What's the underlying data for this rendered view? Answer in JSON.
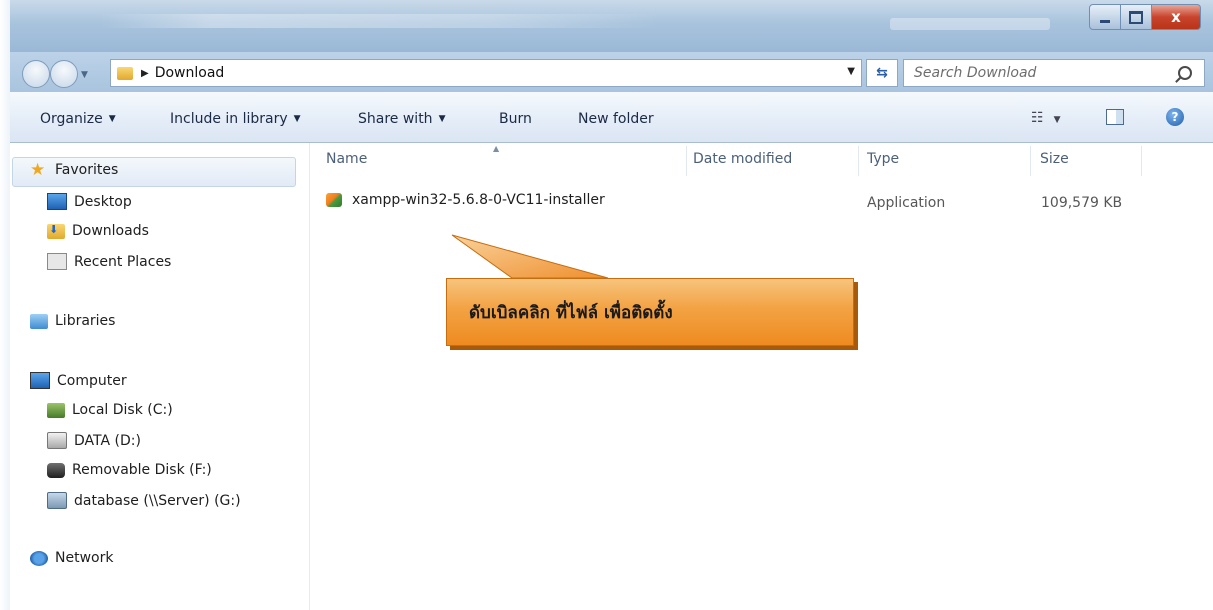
{
  "window": {
    "close_glyph": "x"
  },
  "address_bar": {
    "path": "Download",
    "search_placeholder": "Search Download"
  },
  "toolbar": {
    "organize": "Organize",
    "include_in_library": "Include in library",
    "share_with": "Share with",
    "burn": "Burn",
    "new_folder": "New folder"
  },
  "nav": {
    "favorites": "Favorites",
    "desktop": "Desktop",
    "downloads": "Downloads",
    "recent_places": "Recent Places",
    "libraries": "Libraries",
    "computer": "Computer",
    "local_disk": "Local Disk (C:)",
    "data_drive": "DATA (D:)",
    "removable_disk": "Removable Disk (F:)",
    "network_drive": "database (\\\\Server) (G:)",
    "network": "Network"
  },
  "columns": {
    "name": "Name",
    "date_modified": "Date modified",
    "type": "Type",
    "size": "Size"
  },
  "files": [
    {
      "name": "xampp-win32-5.6.8-0-VC11-installer",
      "date_modified": "",
      "type": "Application",
      "size": "109,579 KB"
    }
  ],
  "callout": {
    "text": "ดับเบิลคลิก ที่ไฟล์ เพื่อติดตั้ง"
  },
  "colors": {
    "callout_orange": "#f3a243",
    "close_red": "#c8442d",
    "chrome_blue": "#a8c3dd"
  }
}
